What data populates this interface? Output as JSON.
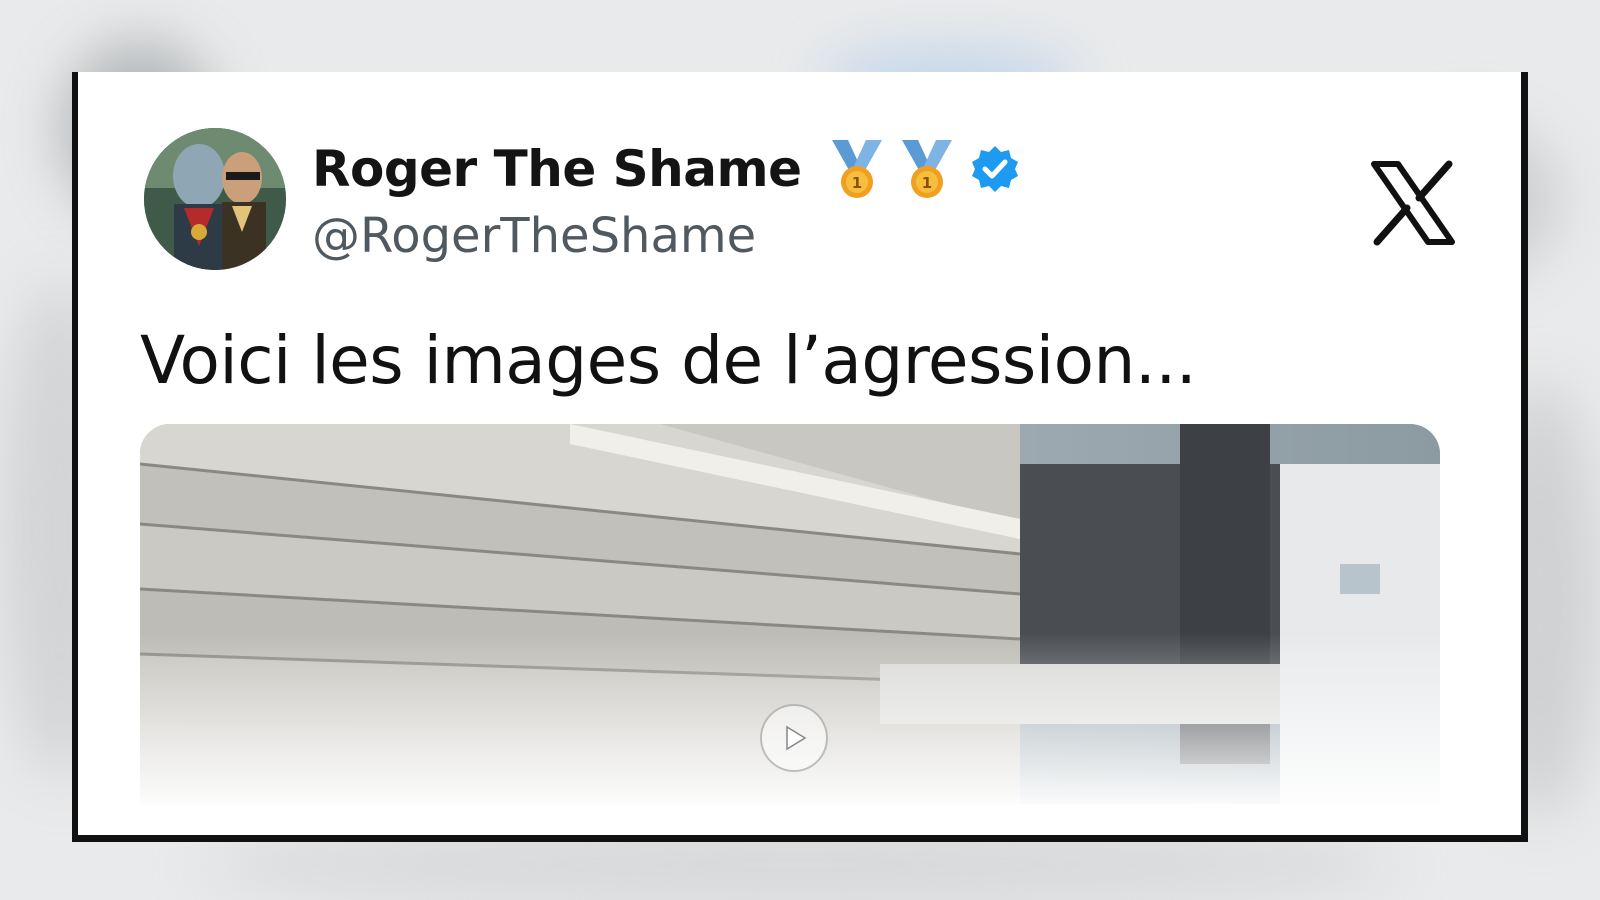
{
  "tweet": {
    "display_name": "Roger The Shame",
    "handle": "@RogerTheShame",
    "text": "Voici les images de l’agression...",
    "verified": true,
    "badge_icons": [
      "gold-medal-icon",
      "gold-medal-icon",
      "verified-badge-icon"
    ],
    "platform_icon": "x-logo-icon"
  },
  "colors": {
    "verified_blue": "#1d9bf0",
    "medal_gold": "#f0a020",
    "ribbon_blue": "#5b9bd5",
    "text_primary": "#141414",
    "text_secondary": "#505860"
  }
}
